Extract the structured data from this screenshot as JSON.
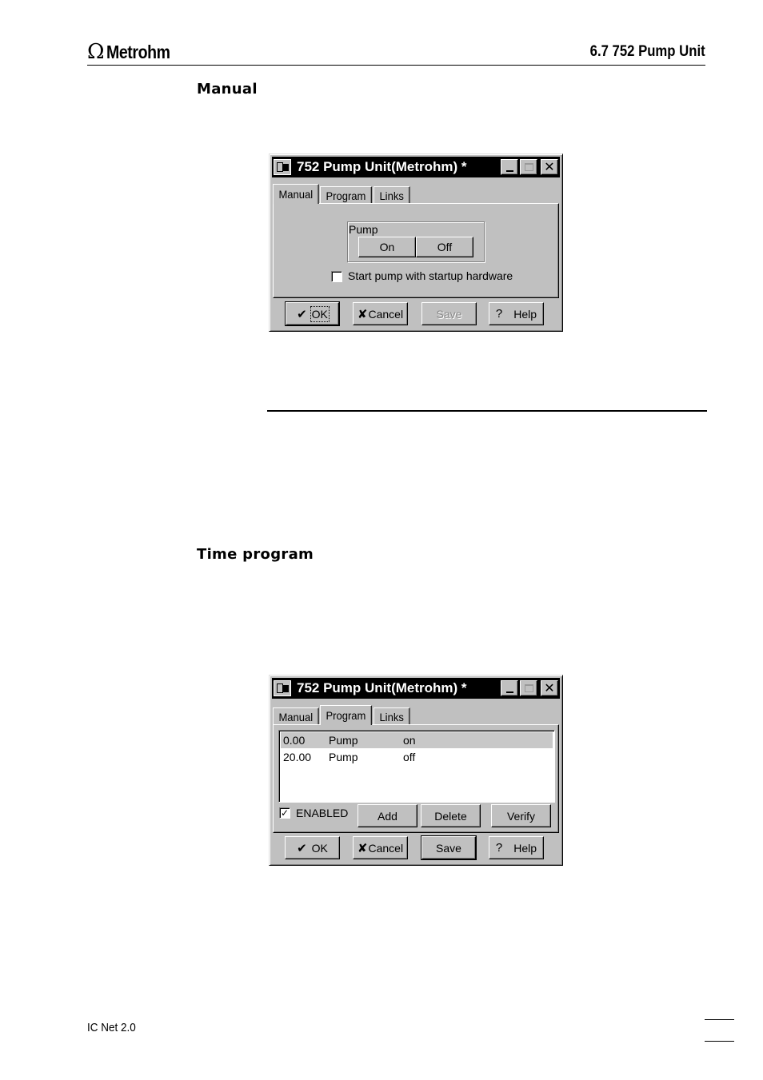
{
  "header": {
    "logo_symbol": "Ω",
    "logo_text": "Metrohm",
    "section_title": "6.7  752 Pump Unit"
  },
  "sections": {
    "manual_heading": "Manual",
    "time_program_heading": "Time program"
  },
  "dialog_manual": {
    "title": "752 Pump Unit(Metrohm) *",
    "tabs": [
      "Manual",
      "Program",
      "Links"
    ],
    "active_tab": "Manual",
    "pump_group": {
      "label": "Pump",
      "on_label": "On",
      "off_label": "Off"
    },
    "startup_checkbox": {
      "label": "Start pump with startup hardware",
      "checked": false
    },
    "buttons": {
      "ok": "OK",
      "cancel": "Cancel",
      "save": "Save",
      "help": "Help"
    },
    "save_disabled": true
  },
  "dialog_program": {
    "title": "752 Pump Unit(Metrohm) *",
    "tabs": [
      "Manual",
      "Program",
      "Links"
    ],
    "active_tab": "Program",
    "program_rows": [
      {
        "time": "0.00",
        "device": "Pump",
        "action": "on",
        "selected": true
      },
      {
        "time": "20.00",
        "device": "Pump",
        "action": "off",
        "selected": false
      }
    ],
    "enabled_checkbox": {
      "label": "ENABLED",
      "checked": true,
      "mark": "✓"
    },
    "list_buttons": {
      "add": "Add",
      "delete": "Delete",
      "verify": "Verify"
    },
    "buttons": {
      "ok": "OK",
      "cancel": "Cancel",
      "save": "Save",
      "help": "Help"
    },
    "save_disabled": false
  },
  "footer": {
    "product": "IC Net 2.0"
  },
  "icons": {
    "ok_glyph": "✔",
    "cancel_glyph": "✘",
    "help_glyph": "?",
    "close_glyph": "✕"
  }
}
